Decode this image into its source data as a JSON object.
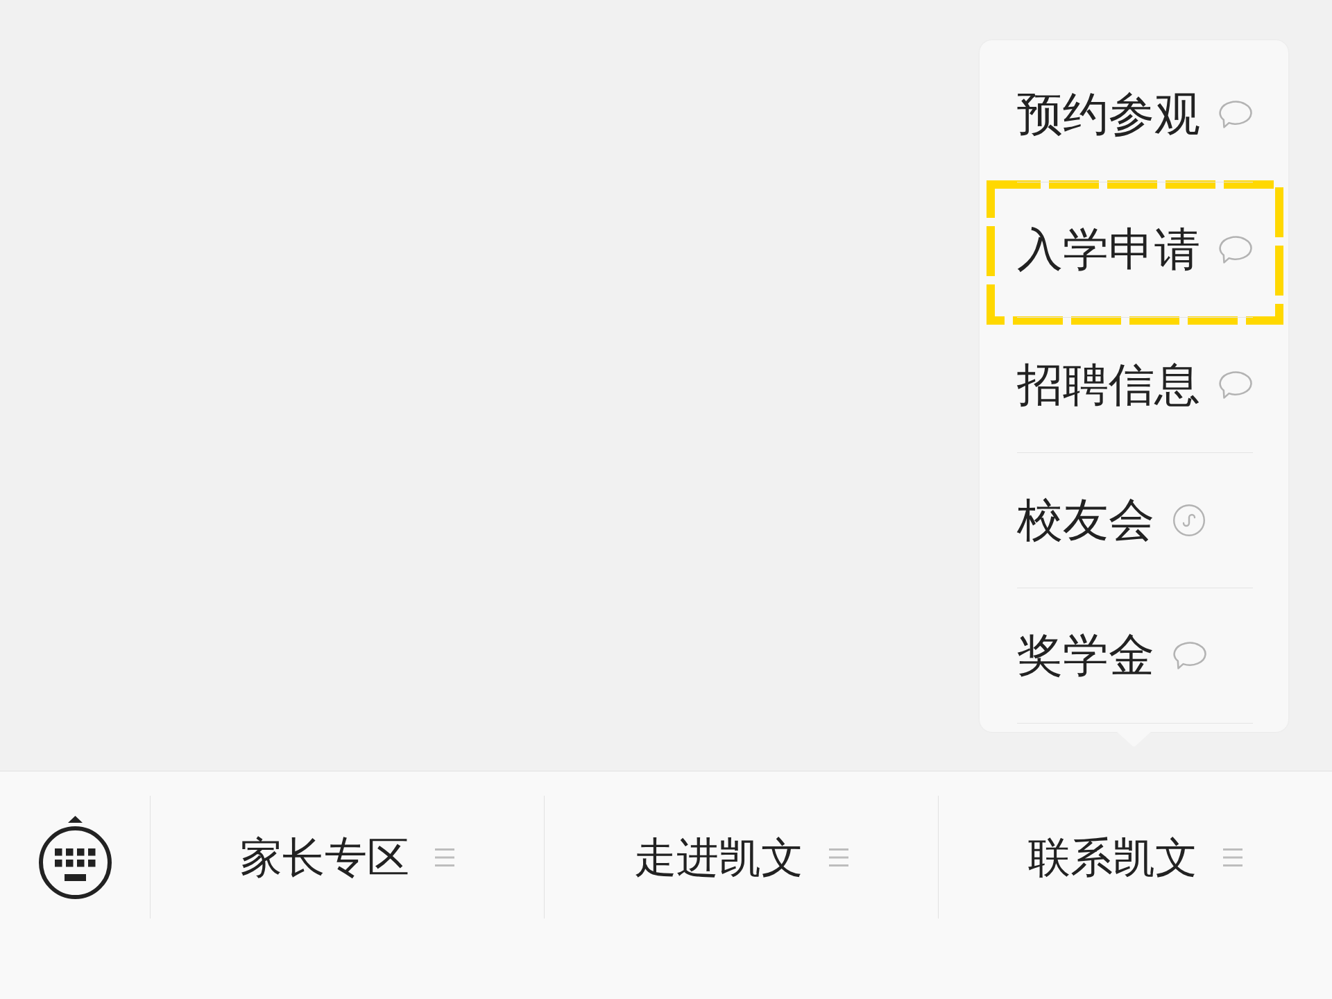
{
  "popup_menu": {
    "items": [
      {
        "label": "预约参观",
        "kind": "message",
        "highlighted": false
      },
      {
        "label": "入学申请",
        "kind": "message",
        "highlighted": true
      },
      {
        "label": "招聘信息",
        "kind": "message",
        "highlighted": false
      },
      {
        "label": "校友会",
        "kind": "miniprogram",
        "highlighted": false
      },
      {
        "label": "奖学金",
        "kind": "message",
        "highlighted": false
      }
    ]
  },
  "bottom_menu": {
    "items": [
      {
        "label": "家长专区"
      },
      {
        "label": "走进凯文"
      },
      {
        "label": "联系凯文"
      }
    ]
  }
}
